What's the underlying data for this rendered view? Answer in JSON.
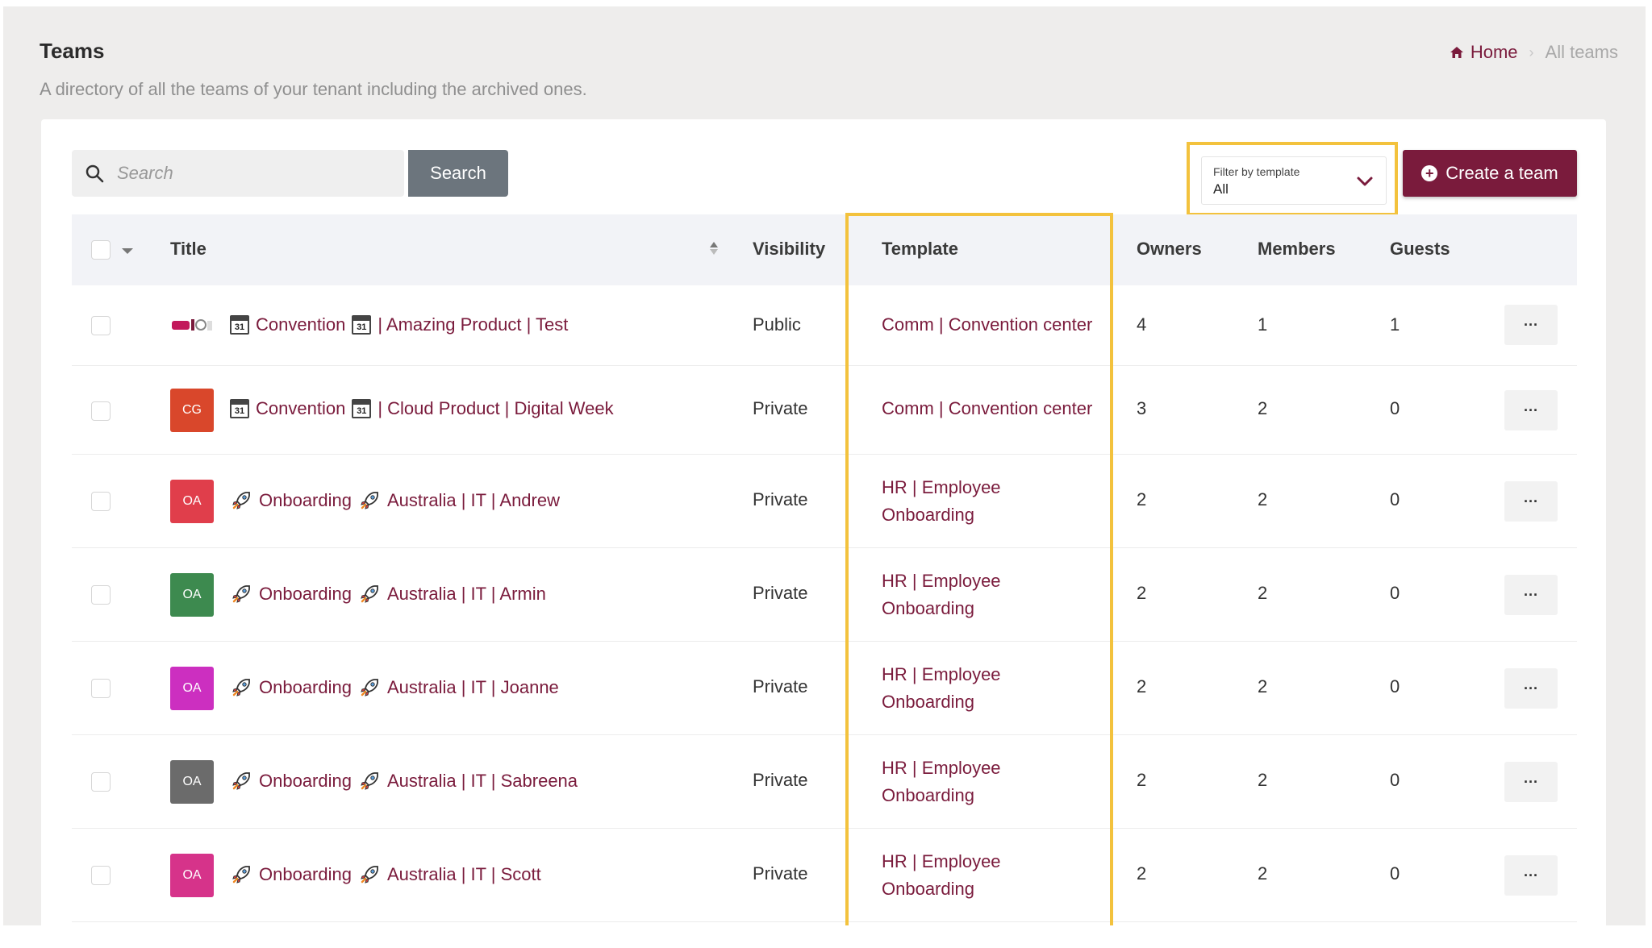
{
  "header": {
    "title": "Teams",
    "subtitle": "A directory of all the teams of your tenant including the archived ones."
  },
  "breadcrumb": {
    "home": "Home",
    "current": "All teams"
  },
  "toolbar": {
    "search_placeholder": "Search",
    "search_button": "Search",
    "filter_label": "Filter by template",
    "filter_value": "All",
    "create_button": "Create a team"
  },
  "table": {
    "columns": {
      "title": "Title",
      "visibility": "Visibility",
      "template": "Template",
      "owners": "Owners",
      "members": "Members",
      "guests": "Guests"
    },
    "rows": [
      {
        "avatar": "",
        "avatar_color": "",
        "prefix_icon": "calendar-icon",
        "prefix": "31",
        "word": "Convention",
        "mid": "31",
        "rest": "| Amazing Product | Test",
        "visibility": "Public",
        "template": "Comm | Convention center",
        "owners": "4",
        "members": "1",
        "guests": "1",
        "more": "···"
      },
      {
        "avatar": "CG",
        "avatar_color": "#d9472b",
        "prefix_icon": "calendar-icon",
        "prefix": "31",
        "word": "Convention",
        "mid": "31",
        "rest": "| Cloud Product | Digital Week",
        "visibility": "Private",
        "template": "Comm | Convention center",
        "owners": "3",
        "members": "2",
        "guests": "0",
        "more": "···"
      },
      {
        "avatar": "OA",
        "avatar_color": "#e03e4b",
        "prefix_icon": "rocket-icon",
        "word": "Onboarding",
        "rest": "Australia | IT | Andrew",
        "visibility": "Private",
        "template_line1": "HR | Employee",
        "template_line2": "Onboarding",
        "owners": "2",
        "members": "2",
        "guests": "0",
        "more": "···"
      },
      {
        "avatar": "OA",
        "avatar_color": "#3d8a4f",
        "prefix_icon": "rocket-icon",
        "word": "Onboarding",
        "rest": "Australia | IT | Armin",
        "visibility": "Private",
        "template_line1": "HR | Employee",
        "template_line2": "Onboarding",
        "owners": "2",
        "members": "2",
        "guests": "0",
        "more": "···"
      },
      {
        "avatar": "OA",
        "avatar_color": "#cc2fc0",
        "prefix_icon": "rocket-icon",
        "word": "Onboarding",
        "rest": "Australia | IT | Joanne",
        "visibility": "Private",
        "template_line1": "HR | Employee",
        "template_line2": "Onboarding",
        "owners": "2",
        "members": "2",
        "guests": "0",
        "more": "···"
      },
      {
        "avatar": "OA",
        "avatar_color": "#6b6b6b",
        "prefix_icon": "rocket-icon",
        "word": "Onboarding",
        "rest": "Australia | IT | Sabreena",
        "visibility": "Private",
        "template_line1": "HR | Employee",
        "template_line2": "Onboarding",
        "owners": "2",
        "members": "2",
        "guests": "0",
        "more": "···"
      },
      {
        "avatar": "OA",
        "avatar_color": "#d6338a",
        "prefix_icon": "rocket-icon",
        "word": "Onboarding",
        "rest": "Australia | IT | Scott",
        "visibility": "Private",
        "template_line1": "HR | Employee",
        "template_line2": "Onboarding",
        "owners": "2",
        "members": "2",
        "guests": "0",
        "more": "···"
      }
    ]
  },
  "colors": {
    "accent": "#7a1b3c",
    "highlight": "#f3c23d",
    "search_button": "#6c757d"
  }
}
